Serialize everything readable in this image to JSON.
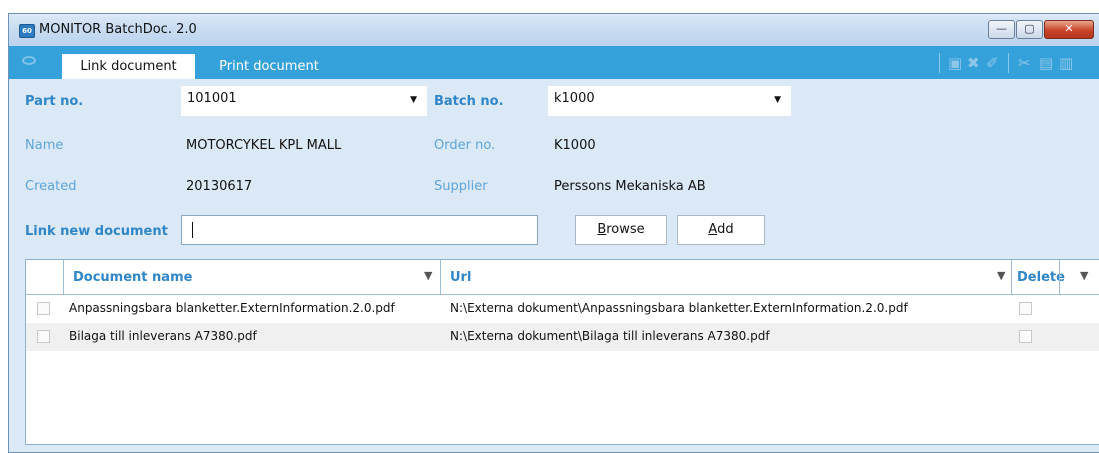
{
  "window": {
    "title": "MONITOR BatchDoc. 2.0",
    "app_icon": "app-logo-icon",
    "controls": {
      "minimize": "—",
      "maximize": "▢",
      "close": "✕"
    }
  },
  "tabs": [
    {
      "label": "Link document",
      "active": true
    },
    {
      "label": "Print document",
      "active": false
    }
  ],
  "toolbar": {
    "icons": [
      "eye-icon",
      "save-icon",
      "delete-icon",
      "eraser-icon",
      "cut-icon",
      "copy-icon",
      "paste-icon"
    ],
    "glyphs": {
      "save": "▣",
      "delete": "✖",
      "eraser": "✐",
      "cut": "✂",
      "copy": "▤",
      "paste": "▥"
    }
  },
  "form": {
    "part_no": {
      "label": "Part no.",
      "value": "101001"
    },
    "batch_no": {
      "label": "Batch no.",
      "value": "k1000"
    },
    "name": {
      "label": "Name",
      "value": "MOTORCYKEL KPL MALL"
    },
    "order_no": {
      "label": "Order no.",
      "value": "K1000"
    },
    "created": {
      "label": "Created",
      "value": "20130617"
    },
    "supplier": {
      "label": "Supplier",
      "value": "Perssons Mekaniska AB"
    },
    "link_new_document": {
      "label": "Link new document",
      "value": ""
    },
    "browse_button": {
      "first": "B",
      "rest": "rowse"
    },
    "add_button": {
      "first": "A",
      "rest": "dd"
    }
  },
  "grid": {
    "columns": {
      "document_name": "Document name",
      "url": "Url",
      "delete": "Delete"
    },
    "rows": [
      {
        "document_name": "Anpassningsbara blanketter.ExternInformation.2.0.pdf",
        "url": "N:\\Externa dokument\\Anpassningsbara blanketter.ExternInformation.2.0.pdf",
        "selected": false,
        "delete": false
      },
      {
        "document_name": "Bilaga till inleverans A7380.pdf",
        "url": "N:\\Externa dokument\\Bilaga till inleverans A7380.pdf",
        "selected": false,
        "delete": false
      }
    ]
  },
  "colors": {
    "accent": "#35a1da",
    "label": "#2f86c8",
    "panel": "#dbe8f5"
  }
}
